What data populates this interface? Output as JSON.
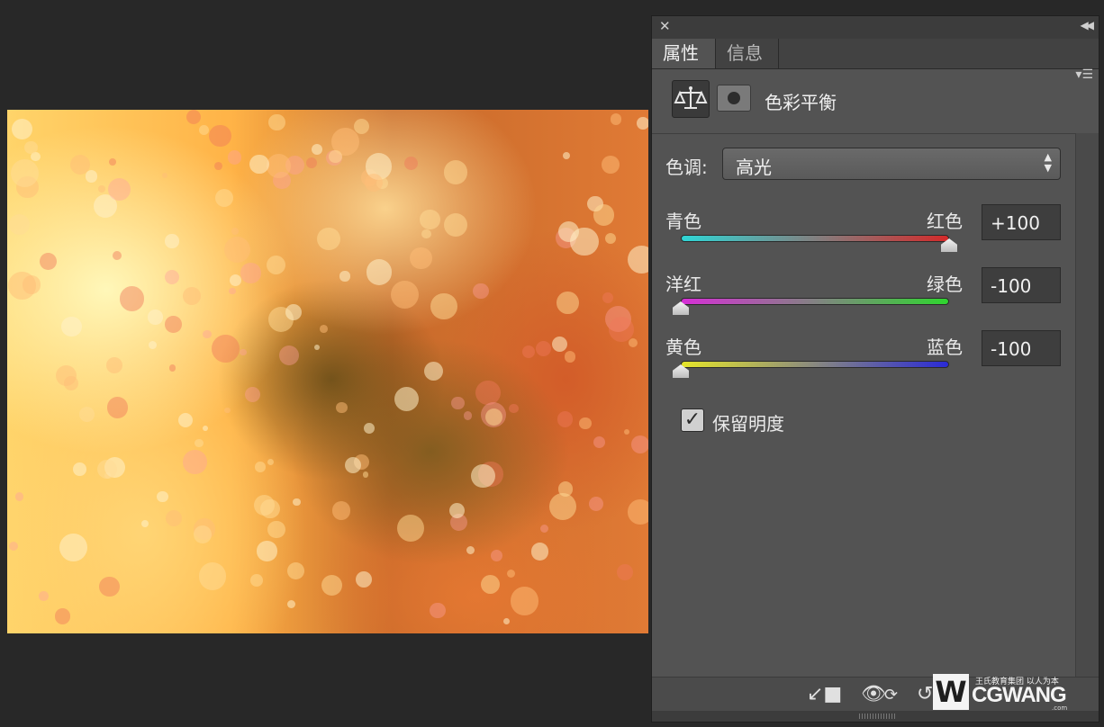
{
  "panel": {
    "tabs": [
      "属性",
      "信息"
    ],
    "adjustment_title": "色彩平衡",
    "tone_label": "色调:",
    "tone_value": "高光",
    "sliders": [
      {
        "left": "青色",
        "right": "红色",
        "value": "+100",
        "position": 1.0
      },
      {
        "left": "洋红",
        "right": "绿色",
        "value": "-100",
        "position": 0.0
      },
      {
        "left": "黄色",
        "right": "蓝色",
        "value": "-100",
        "position": 0.0
      }
    ],
    "preserve_luminosity_label": "保留明度",
    "preserve_luminosity_checked": true
  },
  "watermark": {
    "slogan": "王氏教育集团 以人为本",
    "brand": "CGWANG",
    "suffix": ".com"
  },
  "colors": {
    "panel_bg": "#535353",
    "workspace_bg": "#282828",
    "track_cyan_red": [
      "#2fd6d6",
      "#d42a2a"
    ],
    "track_magenta_green": [
      "#d62fd6",
      "#2fd62f"
    ],
    "track_yellow_blue": [
      "#e6e62a",
      "#2a2ad6"
    ]
  }
}
